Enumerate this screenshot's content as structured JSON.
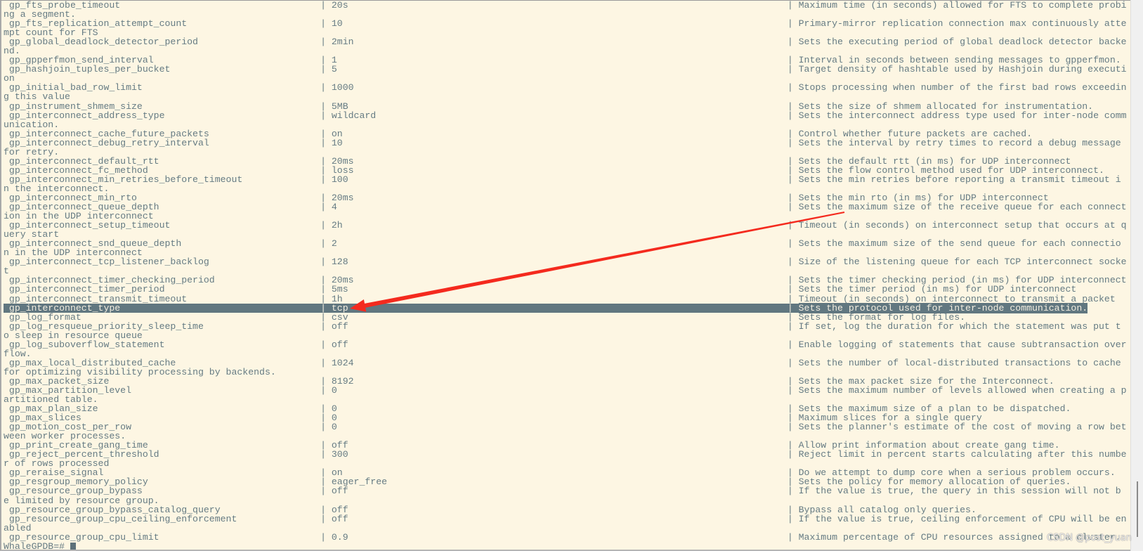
{
  "terminal": {
    "prompt": "WhaleGPDB=# ",
    "highlighted_row": "gp_interconnect_type",
    "colors": {
      "background": "#fdf6e3",
      "text": "#657b83",
      "selection": "#617780",
      "arrow": "#f42a1e"
    },
    "annotation": "red-arrow pointing to gp_interconnect_type value tcp"
  },
  "rows": [
    {
      "name": "gp_fts_probe_timeout",
      "value": "20s",
      "desc": "Maximum time (in seconds) allowed for FTS to complete probing a segment."
    },
    {
      "name": "gp_fts_replication_attempt_count",
      "value": "10",
      "desc": "Primary-mirror replication connection max continuously attempt count for FTS"
    },
    {
      "name": "gp_global_deadlock_detector_period",
      "value": "2min",
      "desc": "Sets the executing period of global deadlock detector backend."
    },
    {
      "name": "gp_gpperfmon_send_interval",
      "value": "1",
      "desc": "Interval in seconds between sending messages to gpperfmon."
    },
    {
      "name": "gp_hashjoin_tuples_per_bucket",
      "value": "5",
      "desc": "Target density of hashtable used by Hashjoin during execution"
    },
    {
      "name": "gp_initial_bad_row_limit",
      "value": "1000",
      "desc": "Stops processing when number of the first bad rows exceeding this value"
    },
    {
      "name": "gp_instrument_shmem_size",
      "value": "5MB",
      "desc": "Sets the size of shmem allocated for instrumentation."
    },
    {
      "name": "gp_interconnect_address_type",
      "value": "wildcard",
      "desc": "Sets the interconnect address type used for inter-node communication."
    },
    {
      "name": "gp_interconnect_cache_future_packets",
      "value": "on",
      "desc": "Control whether future packets are cached."
    },
    {
      "name": "gp_interconnect_debug_retry_interval",
      "value": "10",
      "desc": "Sets the interval by retry times to record a debug message for retry."
    },
    {
      "name": "gp_interconnect_default_rtt",
      "value": "20ms",
      "desc": "Sets the default rtt (in ms) for UDP interconnect"
    },
    {
      "name": "gp_interconnect_fc_method",
      "value": "loss",
      "desc": "Sets the flow control method used for UDP interconnect."
    },
    {
      "name": "gp_interconnect_min_retries_before_timeout",
      "value": "100",
      "desc": "Sets the min retries before reporting a transmit timeout in the interconnect."
    },
    {
      "name": "gp_interconnect_min_rto",
      "value": "20ms",
      "desc": "Sets the min rto (in ms) for UDP interconnect"
    },
    {
      "name": "gp_interconnect_queue_depth",
      "value": "4",
      "desc": "Sets the maximum size of the receive queue for each connection in the UDP interconnect"
    },
    {
      "name": "gp_interconnect_setup_timeout",
      "value": "2h",
      "desc": "Timeout (in seconds) on interconnect setup that occurs at query start"
    },
    {
      "name": "gp_interconnect_snd_queue_depth",
      "value": "2",
      "desc": "Sets the maximum size of the send queue for each connection in the UDP interconnect"
    },
    {
      "name": "gp_interconnect_tcp_listener_backlog",
      "value": "128",
      "desc": "Size of the listening queue for each TCP interconnect socket"
    },
    {
      "name": "gp_interconnect_timer_checking_period",
      "value": "20ms",
      "desc": "Sets the timer checking period (in ms) for UDP interconnect"
    },
    {
      "name": "gp_interconnect_timer_period",
      "value": "5ms",
      "desc": "Sets the timer period (in ms) for UDP interconnect"
    },
    {
      "name": "gp_interconnect_transmit_timeout",
      "value": "1h",
      "desc": "Timeout (in seconds) on interconnect to transmit a packet"
    },
    {
      "name": "gp_interconnect_type",
      "value": "tcp",
      "desc": "Sets the protocol used for inter-node communication."
    },
    {
      "name": "gp_log_format",
      "value": "csv",
      "desc": "Sets the format for log files."
    },
    {
      "name": "gp_log_resqueue_priority_sleep_time",
      "value": "off",
      "desc": "If set, log the duration for which the statement was put to sleep in resource queue"
    },
    {
      "name": "gp_log_suboverflow_statement",
      "value": "off",
      "desc": "Enable logging of statements that cause subtransaction overflow."
    },
    {
      "name": "gp_max_local_distributed_cache",
      "value": "1024",
      "desc": "Sets the number of local-distributed transactions to cache for optimizing visibility processing by backends."
    },
    {
      "name": "gp_max_packet_size",
      "value": "8192",
      "desc": "Sets the max packet size for the Interconnect."
    },
    {
      "name": "gp_max_partition_level",
      "value": "0",
      "desc": "Sets the maximum number of levels allowed when creating a partitioned table."
    },
    {
      "name": "gp_max_plan_size",
      "value": "0",
      "desc": "Sets the maximum size of a plan to be dispatched."
    },
    {
      "name": "gp_max_slices",
      "value": "0",
      "desc": "Maximum slices for a single query"
    },
    {
      "name": "gp_motion_cost_per_row",
      "value": "0",
      "desc": "Sets the planner's estimate of the cost of moving a row between worker processes."
    },
    {
      "name": "gp_print_create_gang_time",
      "value": "off",
      "desc": "Allow print information about create gang time."
    },
    {
      "name": "gp_reject_percent_threshold",
      "value": "300",
      "desc": "Reject limit in percent starts calculating after this number of rows processed"
    },
    {
      "name": "gp_reraise_signal",
      "value": "on",
      "desc": "Do we attempt to dump core when a serious problem occurs."
    },
    {
      "name": "gp_resgroup_memory_policy",
      "value": "eager_free",
      "desc": "Sets the policy for memory allocation of queries."
    },
    {
      "name": "gp_resource_group_bypass",
      "value": "off",
      "desc": "If the value is true, the query in this session will not be limited by resource group."
    },
    {
      "name": "gp_resource_group_bypass_catalog_query",
      "value": "off",
      "desc": "Bypass all catalog only queries."
    },
    {
      "name": "gp_resource_group_cpu_ceiling_enforcement",
      "value": "off",
      "desc": "If the value is true, ceiling enforcement of CPU will be enabled"
    },
    {
      "name": "gp_resource_group_cpu_limit",
      "value": "0.9",
      "desc": "Maximum percentage of CPU resources assigned to a cluster."
    }
  ],
  "watermark": "CSDN @post_yuan"
}
